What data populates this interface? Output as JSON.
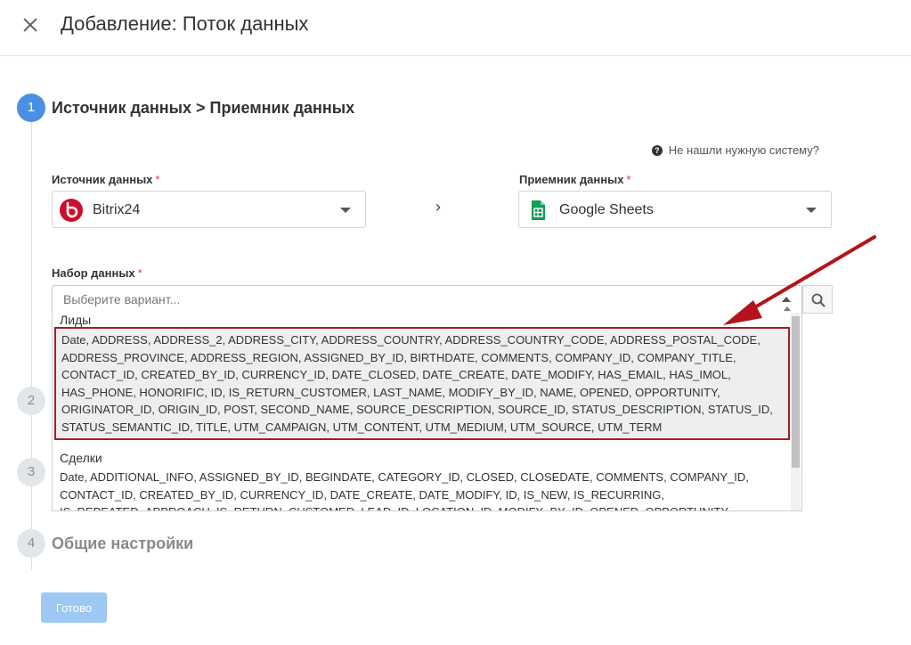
{
  "header": {
    "title": "Добавление: Поток данных"
  },
  "steps": [
    {
      "number": "1",
      "title": "Источник данных > Приемник данных"
    },
    {
      "number": "2",
      "title": ""
    },
    {
      "number": "3",
      "title": ""
    },
    {
      "number": "4",
      "title": "Общие настройки"
    }
  ],
  "help": {
    "icon_text": "?",
    "label": "Не нашли нужную систему?"
  },
  "source": {
    "label": "Источник данных",
    "required": "*",
    "value": "Bitrix24",
    "icon": "bitrix24-logo",
    "brand_color": "#c8102e"
  },
  "direction": {
    "glyph": "›"
  },
  "destination": {
    "label": "Приемник данных",
    "required": "*",
    "value": "Google Sheets",
    "icon": "google-sheets-logo",
    "brand_color": "#0f9d58"
  },
  "dataset": {
    "label": "Набор данных",
    "required": "*",
    "placeholder": "Выберите вариант...",
    "groups": [
      {
        "title": "Лиды",
        "option": "Date, ADDRESS, ADDRESS_2, ADDRESS_CITY, ADDRESS_COUNTRY, ADDRESS_COUNTRY_CODE, ADDRESS_POSTAL_CODE, ADDRESS_PROVINCE, ADDRESS_REGION, ASSIGNED_BY_ID, BIRTHDATE, COMMENTS, COMPANY_ID, COMPANY_TITLE, CONTACT_ID, CREATED_BY_ID, CURRENCY_ID, DATE_CLOSED, DATE_CREATE, DATE_MODIFY, HAS_EMAIL, HAS_IMOL, HAS_PHONE, HONORIFIC, ID, IS_RETURN_CUSTOMER, LAST_NAME, MODIFY_BY_ID, NAME, OPENED, OPPORTUNITY, ORIGINATOR_ID, ORIGIN_ID, POST, SECOND_NAME, SOURCE_DESCRIPTION, SOURCE_ID, STATUS_DESCRIPTION, STATUS_ID, STATUS_SEMANTIC_ID, TITLE, UTM_CAMPAIGN, UTM_CONTENT, UTM_MEDIUM, UTM_SOURCE, UTM_TERM"
      },
      {
        "title": "Сделки",
        "option": "Date, ADDITIONAL_INFO, ASSIGNED_BY_ID, BEGINDATE, CATEGORY_ID, CLOSED, CLOSEDATE, COMMENTS, COMPANY_ID, CONTACT_ID, CREATED_BY_ID, CURRENCY_ID, DATE_CREATE, DATE_MODIFY, ID, IS_NEW, IS_RECURRING, IS_REPEATED_APPROACH, IS_RETURN_CUSTOMER, LEAD_ID, LOCATION_ID, MODIFY_BY_ID, OPENED, OPPORTUNITY, ORIGINATOR_ID, ORIGIN_ID"
      }
    ]
  },
  "footer": {
    "done_label": "Готово"
  },
  "colors": {
    "accent": "#4a90e2",
    "highlight_border": "#a51c24",
    "annotation_arrow": "#b3141b"
  }
}
